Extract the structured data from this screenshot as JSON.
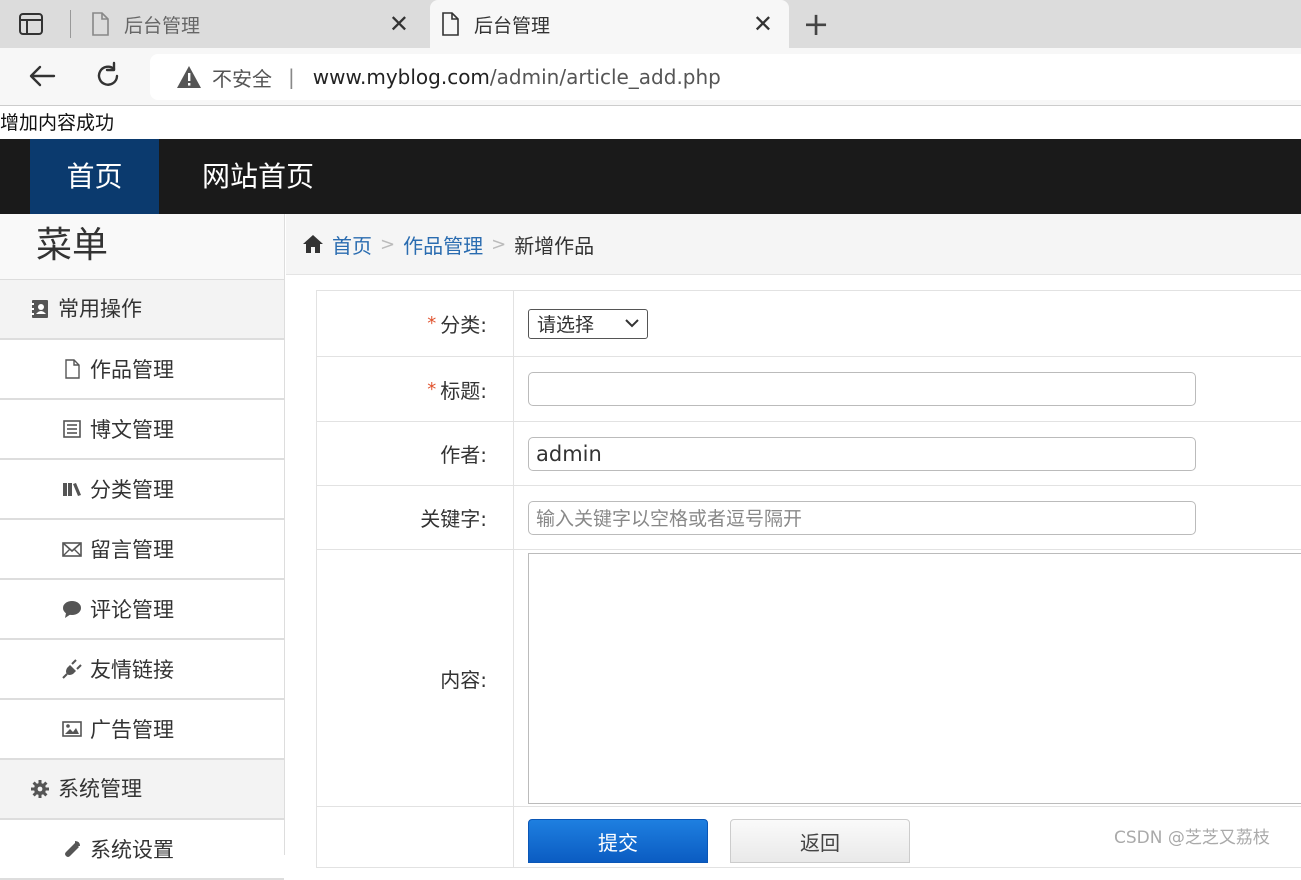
{
  "browser": {
    "tabs": [
      {
        "title": "后台管理",
        "active": false
      },
      {
        "title": "后台管理",
        "active": true
      }
    ],
    "close_glyph": "✕",
    "new_tab_glyph": "+",
    "security_text": "不安全",
    "url_divider": "|",
    "url_host": "www.myblog.com",
    "url_path": "/admin/article_add.php"
  },
  "message": "增加内容成功",
  "topnav": {
    "home": "首页",
    "site_home": "网站首页"
  },
  "sidebar": {
    "title": "菜单",
    "groups": [
      {
        "label": "常用操作",
        "icon": "address-book-icon"
      },
      {
        "label": "系统管理",
        "icon": "gear-icon"
      }
    ],
    "items": [
      {
        "label": "作品管理",
        "icon": "file-icon"
      },
      {
        "label": "博文管理",
        "icon": "list-document-icon"
      },
      {
        "label": "分类管理",
        "icon": "books-icon"
      },
      {
        "label": "留言管理",
        "icon": "envelope-icon"
      },
      {
        "label": "评论管理",
        "icon": "comment-icon"
      },
      {
        "label": "友情链接",
        "icon": "plug-icon"
      },
      {
        "label": "广告管理",
        "icon": "image-icon"
      },
      {
        "label": "系统设置",
        "icon": "wrench-icon"
      }
    ]
  },
  "breadcrumb": {
    "home": "首页",
    "section": "作品管理",
    "current": "新增作品",
    "separator": ">"
  },
  "form": {
    "required_mark": "*",
    "category_label": "分类:",
    "category_value": "请选择",
    "title_label": "标题:",
    "title_value": "",
    "author_label": "作者:",
    "author_value": "admin",
    "keywords_label": "关键字:",
    "keywords_placeholder": "输入关键字以空格或者逗号隔开",
    "content_label": "内容:",
    "submit_label": "提交",
    "back_label": "返回"
  },
  "watermark": "CSDN @芝芝又荔枝"
}
